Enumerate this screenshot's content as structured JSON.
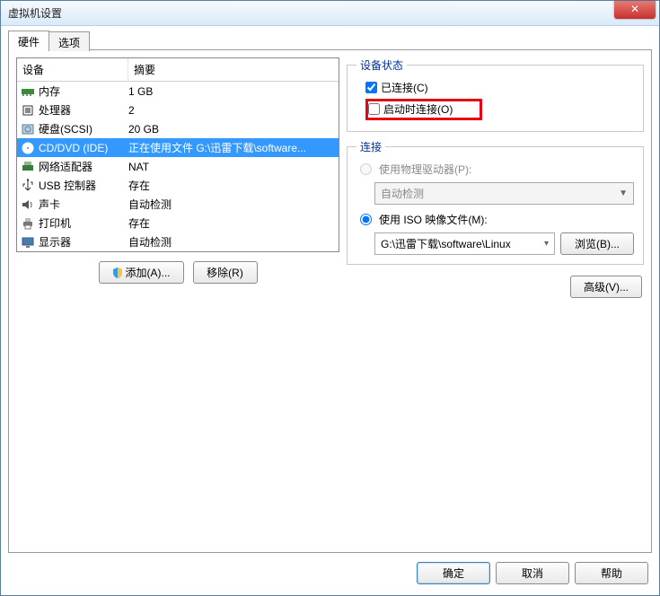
{
  "window": {
    "title": "虚拟机设置"
  },
  "tabs": {
    "hardware": "硬件",
    "options": "选项"
  },
  "columns": {
    "device": "设备",
    "summary": "摘要"
  },
  "devices": [
    {
      "name": "内存",
      "summary": "1 GB",
      "icon": "memory"
    },
    {
      "name": "处理器",
      "summary": "2",
      "icon": "cpu"
    },
    {
      "name": "硬盘(SCSI)",
      "summary": "20 GB",
      "icon": "hdd"
    },
    {
      "name": "CD/DVD (IDE)",
      "summary": "正在使用文件 G:\\迅雷下载\\software...",
      "icon": "cd",
      "selected": true
    },
    {
      "name": "网络适配器",
      "summary": "NAT",
      "icon": "net"
    },
    {
      "name": "USB 控制器",
      "summary": "存在",
      "icon": "usb"
    },
    {
      "name": "声卡",
      "summary": "自动检测",
      "icon": "sound"
    },
    {
      "name": "打印机",
      "summary": "存在",
      "icon": "printer"
    },
    {
      "name": "显示器",
      "summary": "自动检测",
      "icon": "display"
    }
  ],
  "left_buttons": {
    "add": "添加(A)...",
    "remove": "移除(R)"
  },
  "status": {
    "legend": "设备状态",
    "connected": "已连接(C)",
    "connect_at_start": "启动时连接(O)"
  },
  "connection": {
    "legend": "连接",
    "use_physical": "使用物理驱动器(P):",
    "auto_detect": "自动检测",
    "use_iso": "使用 ISO 映像文件(M):",
    "iso_path": "G:\\迅雷下载\\software\\Linux",
    "browse": "浏览(B)..."
  },
  "advanced": "高级(V)...",
  "footer": {
    "ok": "确定",
    "cancel": "取消",
    "help": "帮助"
  }
}
